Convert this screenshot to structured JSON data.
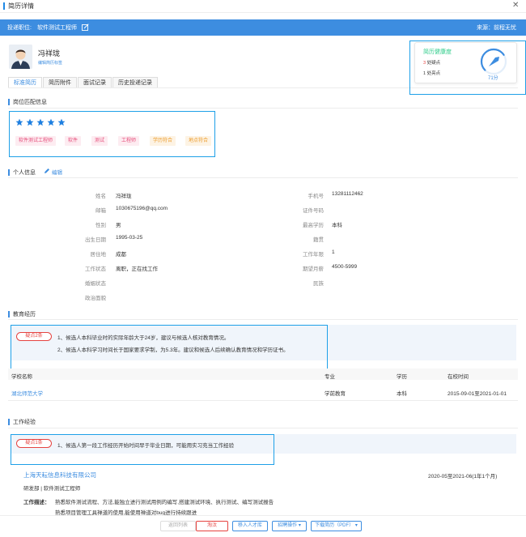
{
  "window": {
    "title": "简历详情",
    "close_icon": "close-icon"
  },
  "header": {
    "position_label": "投递职位:",
    "position_value": "软件测试工程师",
    "source": "来源：前程无忧"
  },
  "profile": {
    "name": "冯祥珑",
    "edit_tags": "编辑简历标签"
  },
  "tabs": [
    "标准简历",
    "简历附件",
    "面试记录",
    "历史投递记录"
  ],
  "health": {
    "title": "简历健康度",
    "doubts_count": "3",
    "doubts_label": " 处疑点",
    "highlights": "1 处亮点",
    "score": "71分",
    "score_value": 71
  },
  "match": {
    "title": "岗位匹配信息",
    "stars": 5,
    "tags": [
      {
        "text": "软件测试工程师",
        "tone": "pink"
      },
      {
        "text": "软件",
        "tone": "pink"
      },
      {
        "text": "测试",
        "tone": "pink"
      },
      {
        "text": "工程师",
        "tone": "pink"
      },
      {
        "text": "学历符合",
        "tone": "orange"
      },
      {
        "text": "地点符合",
        "tone": "orange"
      }
    ]
  },
  "personal": {
    "title": "个人信息",
    "edit": "编辑",
    "left": [
      {
        "label": "姓名",
        "value": "冯祥珑"
      },
      {
        "label": "邮箱",
        "value": "1030675196@qq.com"
      },
      {
        "label": "性别",
        "value": "男"
      },
      {
        "label": "出生日期",
        "value": "1995-03-25"
      },
      {
        "label": "居住地",
        "value": "成都"
      },
      {
        "label": "工作状态",
        "value": "离职，正在找工作"
      },
      {
        "label": "婚姻状态",
        "value": ""
      },
      {
        "label": "政治面貌",
        "value": ""
      }
    ],
    "right": [
      {
        "label": "手机号",
        "value": "13281112462"
      },
      {
        "label": "证件号码",
        "value": ""
      },
      {
        "label": "最高学历",
        "value": "本科"
      },
      {
        "label": "籍贯",
        "value": ""
      },
      {
        "label": "工作年限",
        "value": "1"
      },
      {
        "label": "期望月薪",
        "value": "4500-5999"
      },
      {
        "label": "民族",
        "value": ""
      }
    ]
  },
  "education": {
    "title": "教育经历",
    "badge": "疑点2条",
    "warnings": [
      "1、候选人本科毕业时的实际年龄大于24岁，建议与候选人核对教育情况。",
      "2、候选人本科学习时间长于国家要求学制，为5.3年。建议和候选人后续确认教育情况和学历证书。"
    ],
    "columns": [
      "学校名称",
      "专业",
      "学历",
      "在校时间"
    ],
    "rows": [
      {
        "school": "湖北师范大学",
        "major": "学前教育",
        "degree": "本科",
        "period": "2015-09-01至2021-01-01"
      }
    ]
  },
  "work": {
    "title": "工作经验",
    "badge": "疑点1条",
    "warning": "1、候选人第一段工作经历开始时间早于毕业日期，可能用实习充当工作经验",
    "company": "上海天耘信息科技有限公司",
    "period": "2020-05至2021-06(1年1个月)",
    "dept": "研发部 | 软件测试工程师",
    "desc_label": "工作描述：",
    "desc_lines": [
      "熟悉软件测试流程、方法,能独立进行测试用例的编写,搭建测试环境、执行测试、编写测试报告",
      "熟悉项目管理工具禅道的使用,能使用禅道对bug进行持续跟进"
    ]
  },
  "footer": {
    "back": "返回列表",
    "reject": "淘汰",
    "talent": "移入人才库",
    "hire": "招聘操作",
    "download": "下载简历（PDF）"
  },
  "colors": {
    "accent": "#3d8de0",
    "danger": "#e64340",
    "success": "#2ecc8a",
    "highlight_box": "#1ea0e8"
  }
}
